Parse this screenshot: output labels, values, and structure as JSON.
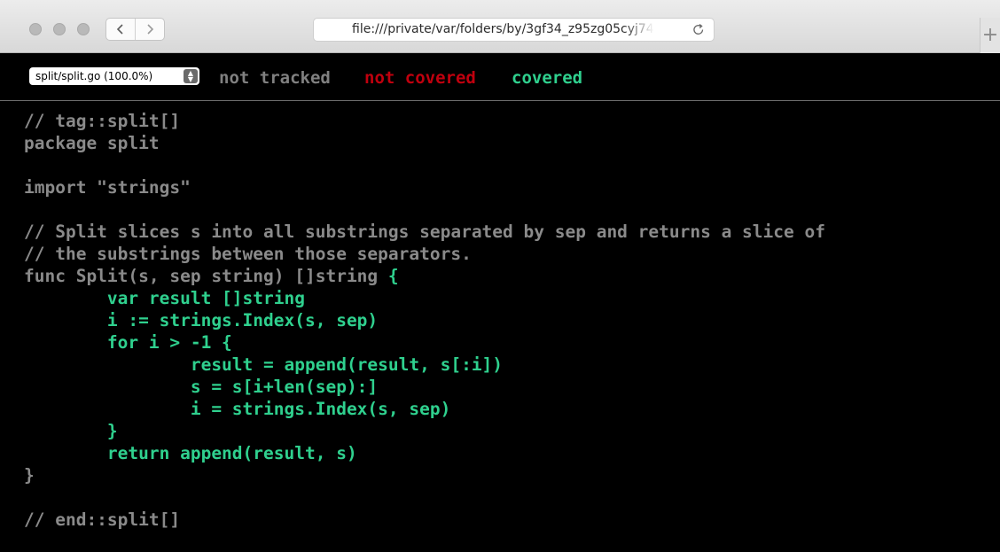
{
  "browser": {
    "url": "file:///private/var/folders/by/3gf34_z95zg05cyj74",
    "back_icon": "chevron-left",
    "forward_icon": "chevron-right",
    "reload_icon": "reload",
    "new_tab_icon": "+"
  },
  "coverage": {
    "file_option": "split/split.go (100.0%)",
    "legend": {
      "not_tracked": "not tracked",
      "not_covered": "not covered",
      "covered": "covered"
    },
    "colors": {
      "not_tracked": "#8a8a8a",
      "not_covered": "#c0000e",
      "covered": "#2fd08e",
      "background": "#000000"
    }
  },
  "code": [
    {
      "segments": [
        {
          "text": "// tag::split[]",
          "status": "not_tracked"
        }
      ]
    },
    {
      "segments": [
        {
          "text": "package split",
          "status": "not_tracked"
        }
      ]
    },
    {
      "segments": [
        {
          "text": "",
          "status": "not_tracked"
        }
      ]
    },
    {
      "segments": [
        {
          "text": "import \"strings\"",
          "status": "not_tracked"
        }
      ]
    },
    {
      "segments": [
        {
          "text": "",
          "status": "not_tracked"
        }
      ]
    },
    {
      "segments": [
        {
          "text": "// Split slices s into all substrings separated by sep and returns a slice of",
          "status": "not_tracked"
        }
      ]
    },
    {
      "segments": [
        {
          "text": "// the substrings between those separators.",
          "status": "not_tracked"
        }
      ]
    },
    {
      "segments": [
        {
          "text": "func Split(s, sep string) []string ",
          "status": "not_tracked"
        },
        {
          "text": "{",
          "status": "covered"
        }
      ]
    },
    {
      "segments": [
        {
          "text": "        var result []string",
          "status": "covered"
        }
      ]
    },
    {
      "segments": [
        {
          "text": "        i := strings.Index(s, sep)",
          "status": "covered"
        }
      ]
    },
    {
      "segments": [
        {
          "text": "        for i > -1 {",
          "status": "covered"
        }
      ]
    },
    {
      "segments": [
        {
          "text": "                result = append(result, s[:i])",
          "status": "covered"
        }
      ]
    },
    {
      "segments": [
        {
          "text": "                s = s[i+len(sep):]",
          "status": "covered"
        }
      ]
    },
    {
      "segments": [
        {
          "text": "                i = strings.Index(s, sep)",
          "status": "covered"
        }
      ]
    },
    {
      "segments": [
        {
          "text": "        }",
          "status": "covered"
        }
      ]
    },
    {
      "segments": [
        {
          "text": "        return append(result, s)",
          "status": "covered"
        }
      ]
    },
    {
      "segments": [
        {
          "text": "}",
          "status": "not_tracked"
        }
      ]
    },
    {
      "segments": [
        {
          "text": "",
          "status": "not_tracked"
        }
      ]
    },
    {
      "segments": [
        {
          "text": "// end::split[]",
          "status": "not_tracked"
        }
      ]
    }
  ]
}
